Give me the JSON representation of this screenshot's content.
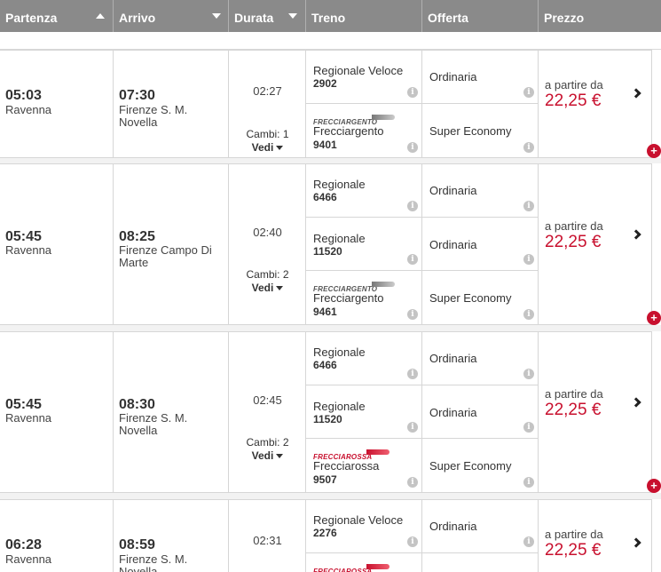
{
  "header": {
    "partenza": "Partenza",
    "arrivo": "Arrivo",
    "durata": "Durata",
    "treno": "Treno",
    "offerta": "Offerta",
    "prezzo": "Prezzo"
  },
  "logos": {
    "frecciargento": "FRECCIARGENTO",
    "frecciarossa": "FRECCIAROSSA"
  },
  "common": {
    "info": "i",
    "vedi": "Vedi",
    "a_partire_da": "a partire da",
    "plus": "+"
  },
  "trips": [
    {
      "dep_time": "05:03",
      "dep_station": "Ravenna",
      "arr_time": "07:30",
      "arr_station": "Firenze S. M. Novella",
      "duration": "02:27",
      "changes": "Cambi: 1",
      "segments": [
        {
          "train": "Regionale Veloce",
          "number": "2902",
          "offer": "Ordinaria",
          "logo": ""
        },
        {
          "train": "Frecciargento",
          "number": "9401",
          "offer": "Super Economy",
          "logo": "frecciargento"
        }
      ],
      "price": "22,25 €"
    },
    {
      "dep_time": "05:45",
      "dep_station": "Ravenna",
      "arr_time": "08:25",
      "arr_station": "Firenze Campo Di Marte",
      "duration": "02:40",
      "changes": "Cambi: 2",
      "segments": [
        {
          "train": "Regionale",
          "number": "6466",
          "offer": "Ordinaria",
          "logo": ""
        },
        {
          "train": "Regionale",
          "number": "11520",
          "offer": "Ordinaria",
          "logo": ""
        },
        {
          "train": "Frecciargento",
          "number": "9461",
          "offer": "Super Economy",
          "logo": "frecciargento"
        }
      ],
      "price": "22,25 €"
    },
    {
      "dep_time": "05:45",
      "dep_station": "Ravenna",
      "arr_time": "08:30",
      "arr_station": "Firenze S. M. Novella",
      "duration": "02:45",
      "changes": "Cambi: 2",
      "segments": [
        {
          "train": "Regionale",
          "number": "6466",
          "offer": "Ordinaria",
          "logo": ""
        },
        {
          "train": "Regionale",
          "number": "11520",
          "offer": "Ordinaria",
          "logo": ""
        },
        {
          "train": "Frecciarossa",
          "number": "9507",
          "offer": "Super Economy",
          "logo": "frecciarossa"
        }
      ],
      "price": "22,25 €"
    },
    {
      "dep_time": "06:28",
      "dep_station": "Ravenna",
      "arr_time": "08:59",
      "arr_station": "Firenze S. M. Novella",
      "duration": "02:31",
      "changes": "",
      "segments": [
        {
          "train": "Regionale Veloce",
          "number": "2276",
          "offer": "Ordinaria",
          "logo": ""
        },
        {
          "train": "",
          "number": "",
          "offer": "",
          "logo": "frecciarossa"
        }
      ],
      "price": "22,25 €"
    }
  ],
  "colors": {
    "header_bg": "#8a8a8a",
    "price_red": "#c8102e"
  }
}
